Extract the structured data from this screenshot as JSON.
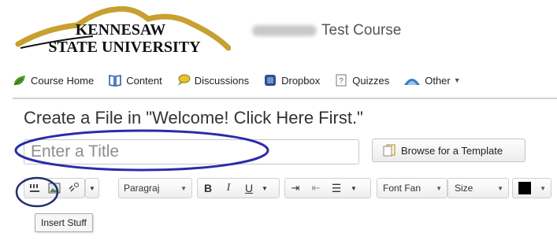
{
  "header": {
    "logo_line1": "KENNESAW",
    "logo_line2": "STATE UNIVERSITY",
    "course_title": "Test Course"
  },
  "nav": {
    "items": [
      {
        "label": "Course Home",
        "icon": "leaf-icon"
      },
      {
        "label": "Content",
        "icon": "book-icon"
      },
      {
        "label": "Discussions",
        "icon": "chat-bubble-icon"
      },
      {
        "label": "Dropbox",
        "icon": "dropbox-icon"
      },
      {
        "label": "Quizzes",
        "icon": "quiz-icon"
      },
      {
        "label": "Other",
        "icon": "globe-icon"
      }
    ]
  },
  "page": {
    "title": "Create a File in \"Welcome! Click Here First.\"",
    "title_placeholder": "Enter a Title",
    "browse_label": "Browse for a Template"
  },
  "toolbar": {
    "paragraph_label": "Paragraj",
    "font_family_label": "Font Fan",
    "size_label": "Size",
    "bold": "B",
    "italic": "I",
    "underline": "U",
    "text_color": "#000000"
  },
  "tooltip": {
    "text": "Insert Stuff"
  },
  "colors": {
    "highlight": "#2b2ba8",
    "logo_gold": "#c8a030"
  }
}
